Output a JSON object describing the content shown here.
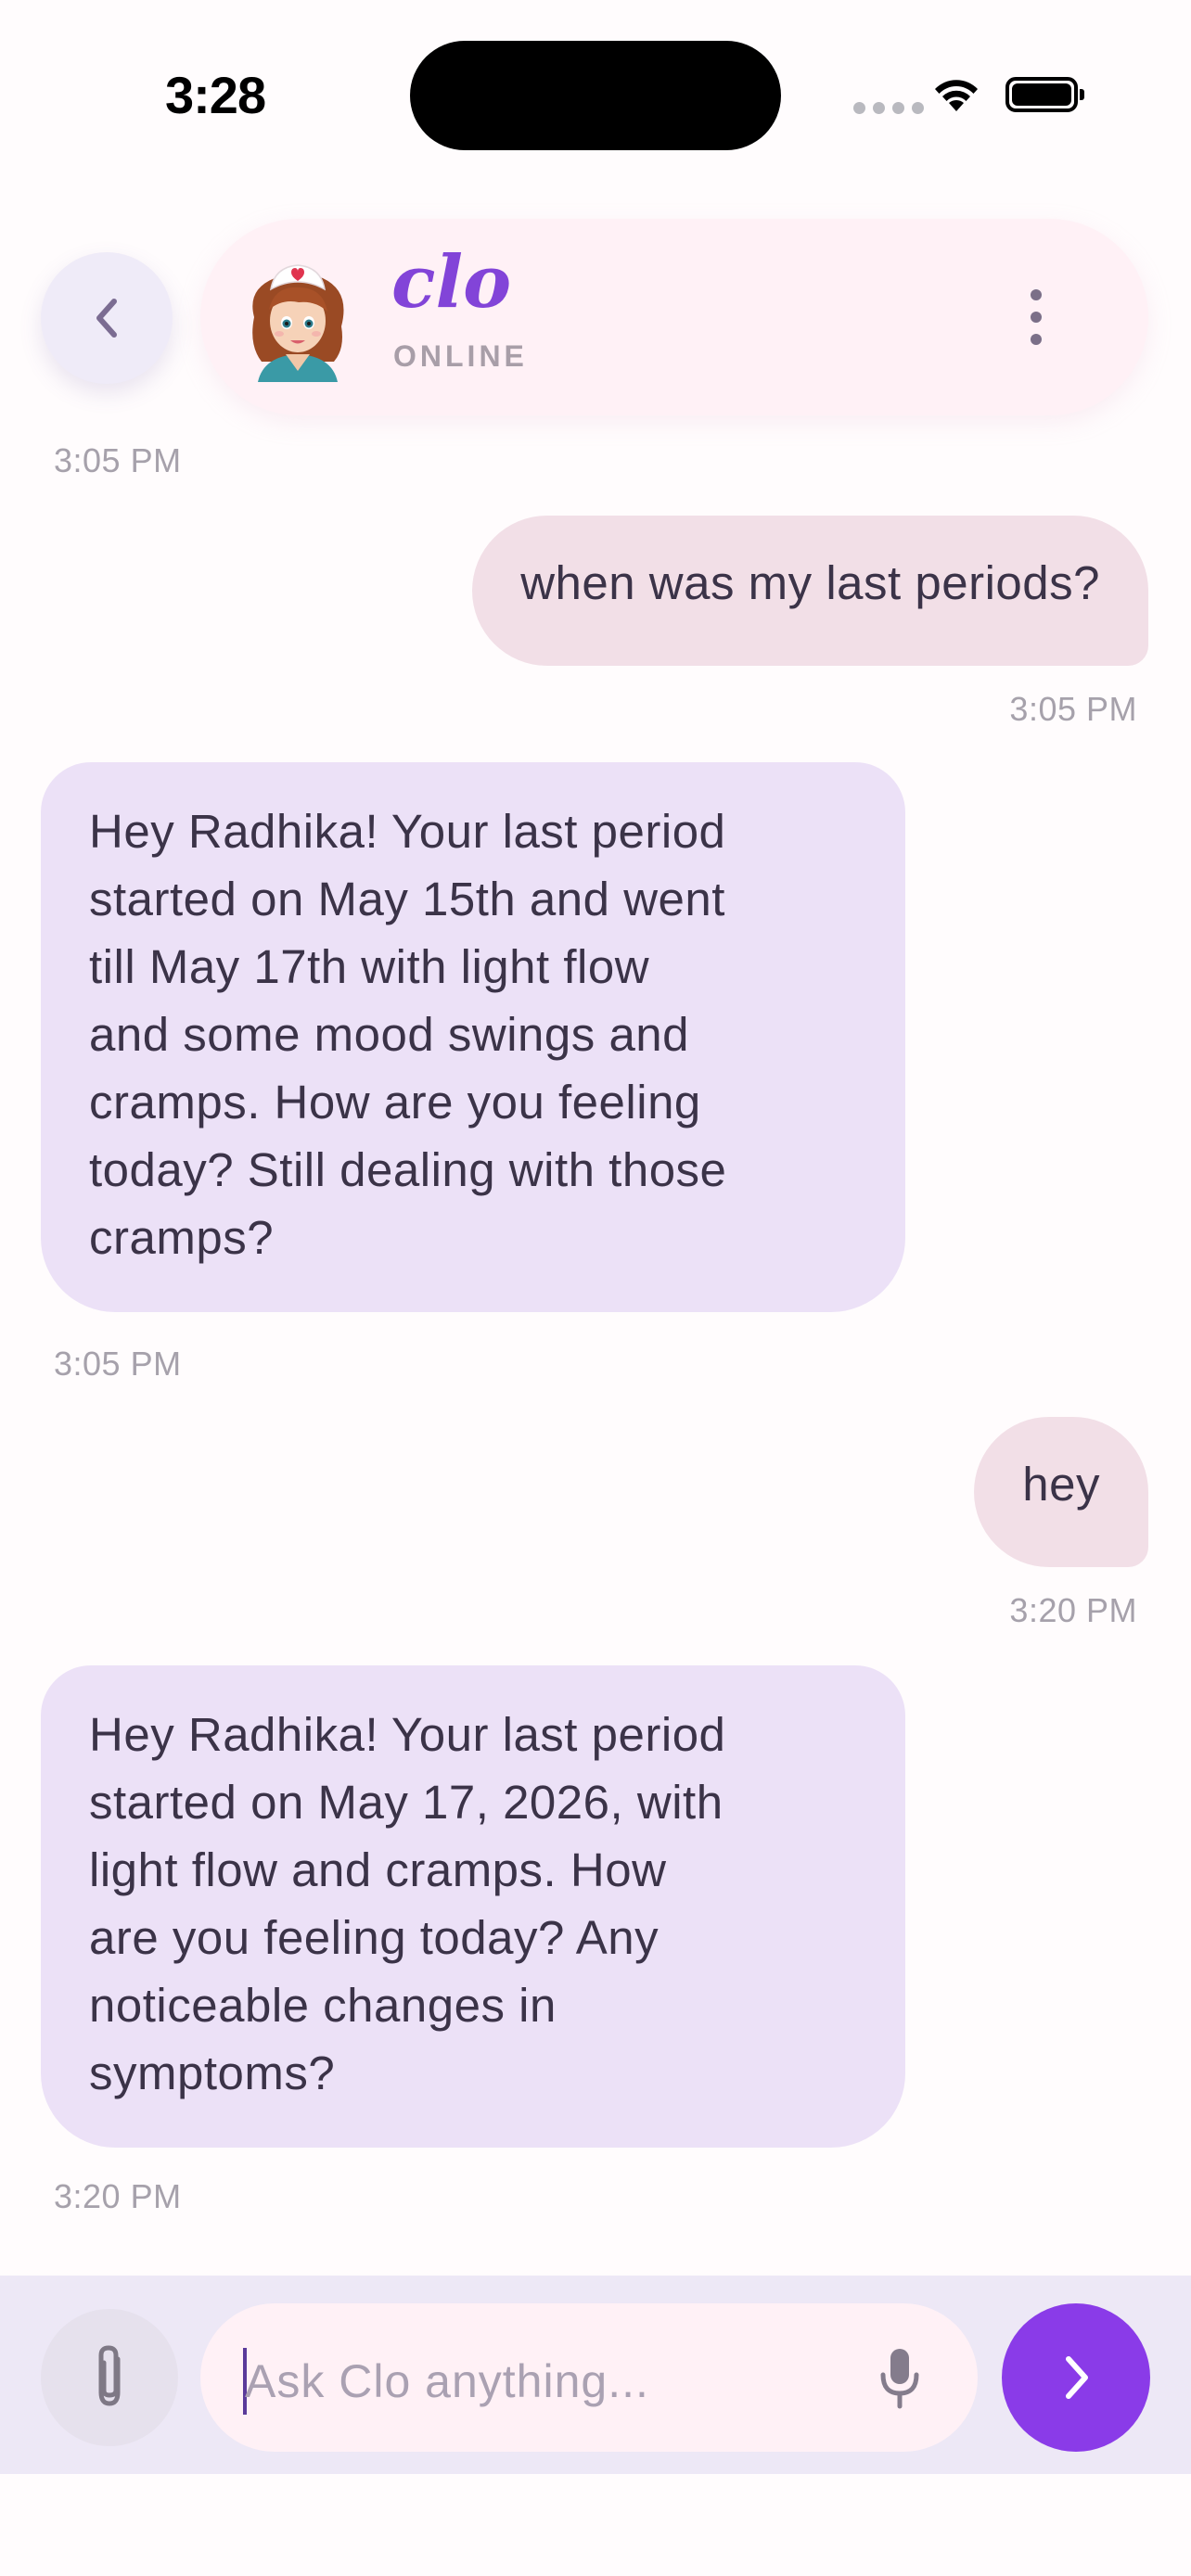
{
  "status_bar": {
    "time": "3:28"
  },
  "header": {
    "bot_name": "clo",
    "bot_status": "ONLINE",
    "icons": [
      "chevron-left-icon",
      "avatar-nurse",
      "more-vertical-icon"
    ]
  },
  "messages": [
    {
      "type": "timestamp",
      "side": "left",
      "text": "3:05 PM"
    },
    {
      "type": "user",
      "text": "when was my last periods?"
    },
    {
      "type": "timestamp",
      "side": "right",
      "text": "3:05 PM"
    },
    {
      "type": "bot",
      "lines": [
        "Hey Radhika! Your last period",
        "started on May 15th and went",
        "till May 17th with light flow",
        "and some mood swings and",
        "cramps. How are you feeling",
        "today? Still dealing with those",
        "cramps?"
      ]
    },
    {
      "type": "timestamp",
      "side": "left",
      "text": "3:05 PM"
    },
    {
      "type": "user",
      "text": "hey"
    },
    {
      "type": "timestamp",
      "side": "right",
      "text": "3:20 PM"
    },
    {
      "type": "bot",
      "lines": [
        "Hey Radhika! Your last period",
        "started on May 17, 2026, with",
        "light flow and cramps. How",
        "are you feeling today? Any",
        "noticeable changes in",
        "symptoms?"
      ]
    },
    {
      "type": "timestamp",
      "side": "left",
      "text": "3:20 PM"
    }
  ],
  "composer": {
    "placeholder": "Ask Clo anything...",
    "value": "",
    "icons": [
      "paperclip-icon",
      "microphone-icon",
      "chevron-right-icon"
    ]
  },
  "colors": {
    "accent": "#8a3be8",
    "bot_name": "#8244d8",
    "user_bubble": "#f2dfe7",
    "bot_bubble": "#ece1f7",
    "header_card": "#fff1f6"
  }
}
